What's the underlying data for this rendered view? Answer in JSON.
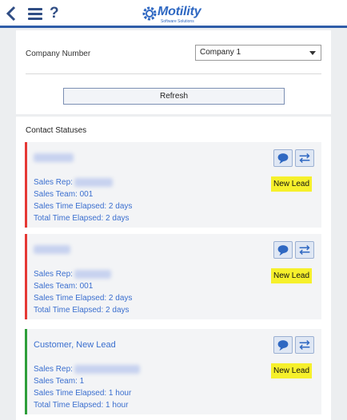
{
  "header": {
    "back_icon": "chevron-left-icon",
    "menu_icon": "hamburger-menu-icon",
    "help_label": "?",
    "logo_text": "Motility",
    "logo_subtitle": "Software Solutions",
    "accent_color": "#2f5da8"
  },
  "company": {
    "label": "Company Number",
    "selected": "Company 1"
  },
  "refresh_label": "Refresh",
  "statuses": {
    "title": "Contact Statuses",
    "cards": [
      {
        "name": "",
        "bar_color": "#e53935",
        "sales_rep_label": "Sales Rep:",
        "sales_rep": "",
        "sales_team": "Sales Team: 001",
        "sales_time": "Sales Time Elapsed: 2 days",
        "total_time": "Total Time Elapsed: 2 days",
        "badge": "New Lead"
      },
      {
        "name": "",
        "bar_color": "#e53935",
        "sales_rep_label": "Sales Rep:",
        "sales_rep": "",
        "sales_team": "Sales Team: 001",
        "sales_time": "Sales Time Elapsed: 2 days",
        "total_time": "Total Time Elapsed: 2 days",
        "badge": "New Lead"
      },
      {
        "name": "Customer, New Lead",
        "bar_color": "#2e9e3a",
        "sales_rep_label": "Sales Rep:",
        "sales_rep": "",
        "sales_team": "Sales Team: 1",
        "sales_time": "Sales Time Elapsed: 1 hour",
        "total_time": "Total Time Elapsed: 1 hour",
        "badge": "New Lead"
      }
    ]
  }
}
